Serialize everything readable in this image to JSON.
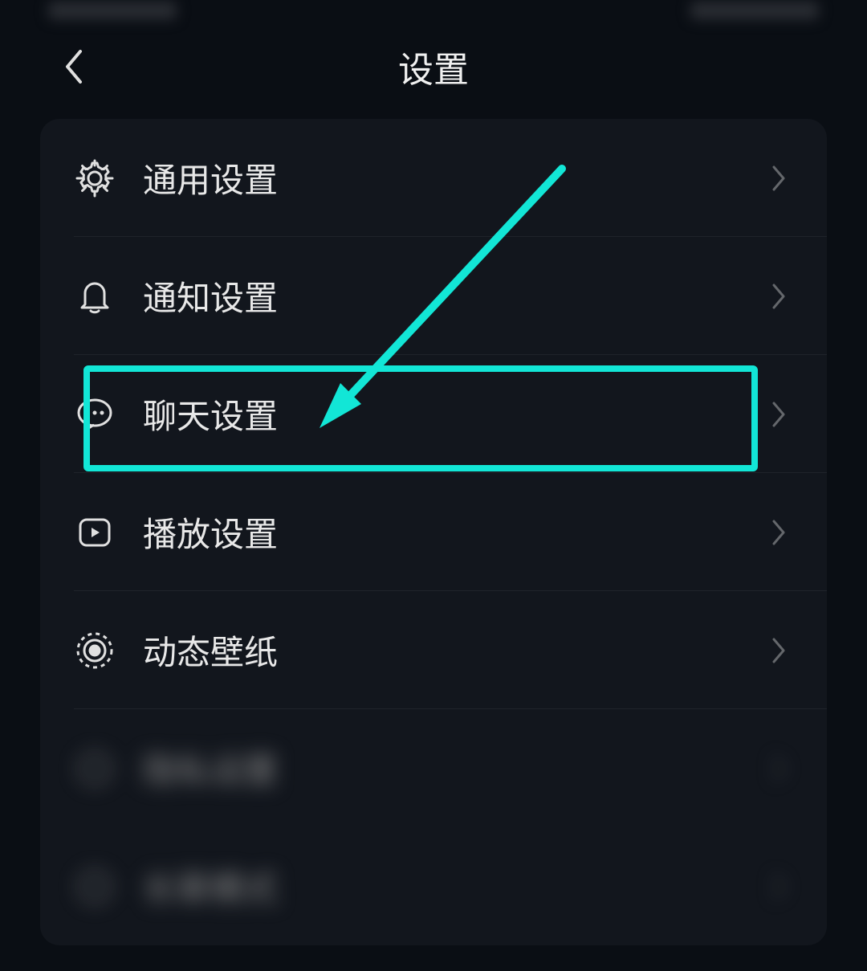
{
  "header": {
    "title": "设置"
  },
  "items": [
    {
      "icon": "gear",
      "label": "通用设置",
      "blurred": false
    },
    {
      "icon": "bell",
      "label": "通知设置",
      "blurred": false
    },
    {
      "icon": "chat",
      "label": "聊天设置",
      "blurred": false,
      "highlighted": true
    },
    {
      "icon": "play",
      "label": "播放设置",
      "blurred": false
    },
    {
      "icon": "target",
      "label": "动态壁纸",
      "blurred": false
    },
    {
      "icon": "blur1",
      "label": "隐私设置",
      "blurred": true
    },
    {
      "icon": "blur2",
      "label": "长辈模式",
      "blurred": true
    }
  ],
  "annotation": {
    "highlight_color": "#12e6d6"
  }
}
